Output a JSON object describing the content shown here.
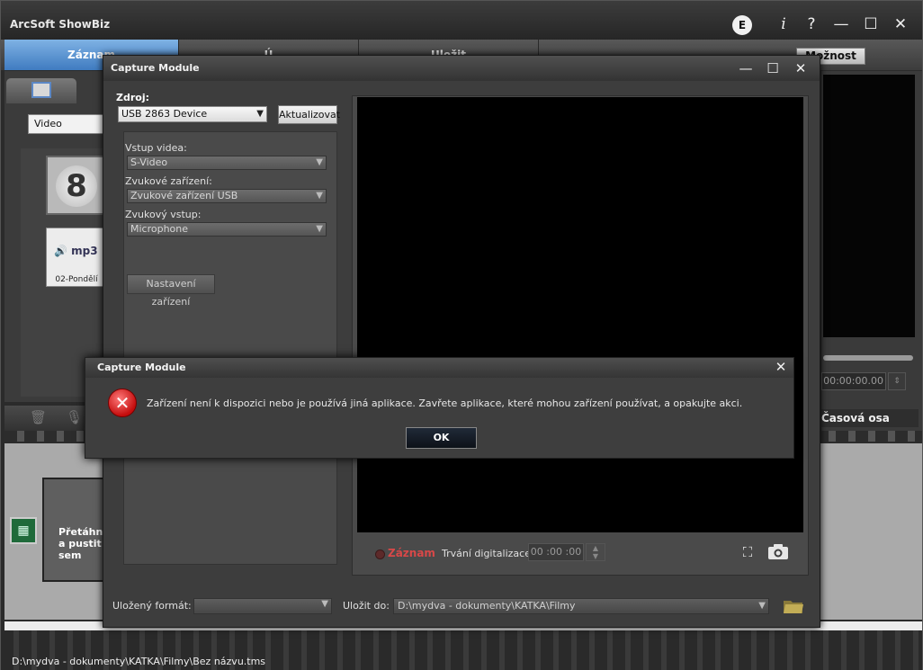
{
  "app": {
    "title": "ArcSoft ShowBiz",
    "edit_badge": "E",
    "controls": {
      "info": "i",
      "help": "?",
      "minimize": "—",
      "maximize": "☐",
      "close": "✕"
    }
  },
  "tabs": {
    "zaznam": "Záznam",
    "u": "Ú",
    "ulozit": "Uložit"
  },
  "moznost_button": "Možnost",
  "library": {
    "filter_value": "Video",
    "thumb_counter": "8",
    "thumb_mp3_text": "mp3",
    "thumb_mp3_name": "02-Pondělí"
  },
  "storyboard": {
    "drop_hint": "Přetáhněte a pustit sem"
  },
  "status_path": "D:\\mydva - dokumenty\\KATKA\\Filmy\\Bez názvu.tms",
  "right_panel": {
    "time": "00:00:00.00",
    "timeline_label": "Časová osa"
  },
  "capture": {
    "title": "Capture Module",
    "source_label": "Zdroj:",
    "source_value": "USB 2863 Device",
    "refresh_button": "Aktualizovat",
    "video_input_label": "Vstup videa:",
    "video_input_value": "S-Video",
    "audio_device_label": "Zvukové zařízení:",
    "audio_device_value": "Zvukové zařízení USB",
    "audio_input_label": "Zvukový vstup:",
    "audio_input_value": "Microphone",
    "device_settings_button": "Nastavení zařízení",
    "record_label": "Záznam",
    "duration_label": "Trvání digitalizace:",
    "duration_value": "00 :00 :00",
    "format_label": "Uložený formát:",
    "format_value": "",
    "saveto_label": "Uložit do:",
    "saveto_value": "D:\\mydva - dokumenty\\KATKA\\Filmy"
  },
  "error_dialog": {
    "title": "Capture Module",
    "message": "Zařízení není k dispozici nebo je používá jiná aplikace. Zavřete aplikace, které mohou zařízení používat, a opakujte akci.",
    "ok_button": "OK"
  },
  "colors": {
    "active_tab": "#5a92d0",
    "record_red": "#d84848",
    "error_red": "#c40d0d"
  }
}
